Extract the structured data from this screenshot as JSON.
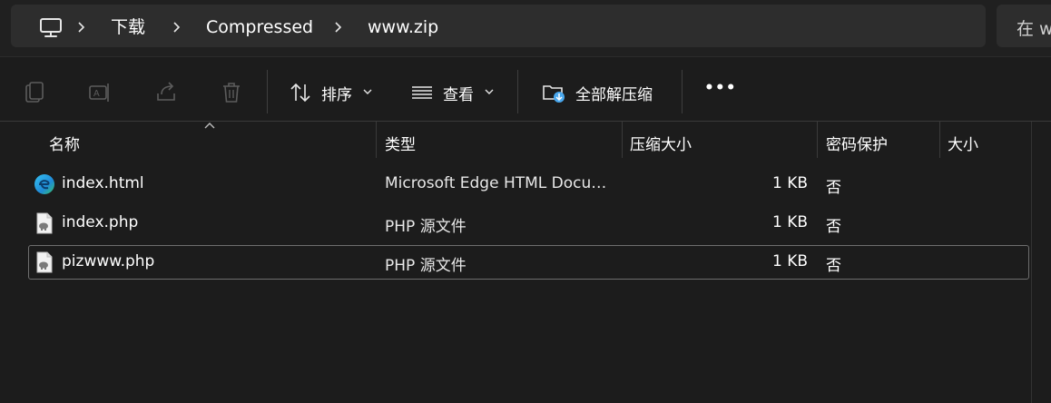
{
  "breadcrumb": {
    "items": [
      "下载",
      "Compressed",
      "www.zip"
    ]
  },
  "search": {
    "text": "在 w"
  },
  "toolbar": {
    "copy_icon": "copy-icon",
    "rename_icon": "rename-icon",
    "share_icon": "share-icon",
    "delete_icon": "delete-icon",
    "sort_label": "排序",
    "view_label": "查看",
    "extract_all_label": "全部解压缩",
    "more_label": "•••"
  },
  "columns": {
    "name": "名称",
    "type": "类型",
    "compressed_size": "压缩大小",
    "password_protected": "密码保护",
    "size": "大小"
  },
  "files": [
    {
      "name": "index.html",
      "type": "Microsoft Edge HTML Docu…",
      "compressed_size": "1 KB",
      "password": "否",
      "size": "",
      "icon": "edge-html-icon"
    },
    {
      "name": "index.php",
      "type": "PHP 源文件",
      "compressed_size": "1 KB",
      "password": "否",
      "size": "",
      "icon": "php-file-icon"
    },
    {
      "name": "pizwww.php",
      "type": "PHP 源文件",
      "compressed_size": "1 KB",
      "password": "否",
      "size": "",
      "icon": "php-file-icon"
    }
  ],
  "colors": {
    "background": "#1c1c1c",
    "address_bar": "#2d2d2d",
    "accent_blue": "#4aa8ee"
  }
}
